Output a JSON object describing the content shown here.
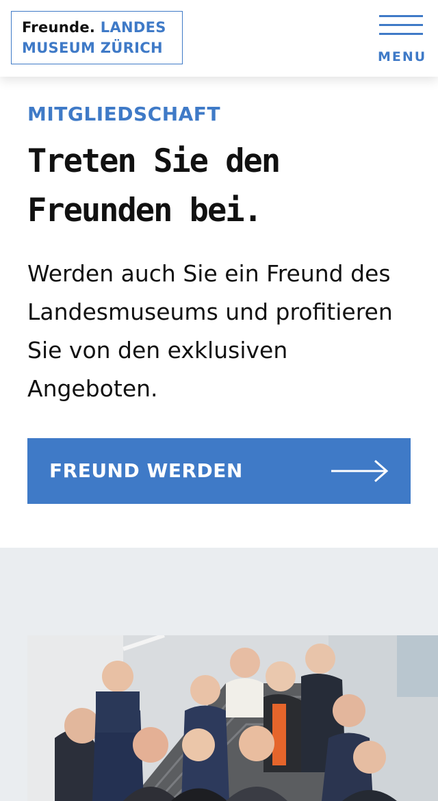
{
  "header": {
    "logo": {
      "part_dark": "Freunde.",
      "part_blue": "LANDES",
      "line2": "MUSEUM ZÜRICH"
    },
    "menu_label": "MENU"
  },
  "main": {
    "eyebrow": "MITGLIEDSCHAFT",
    "headline_line1": "Treten Sie den",
    "headline_line2": "Freunden bei.",
    "intro": "Werden auch Sie ein Freund des Landesmuseums und profitieren Sie von den exklusiven Angeboten.",
    "cta_label": "FREUND WERDEN",
    "cta_icon": "arrow-right-icon"
  },
  "colors": {
    "accent": "#3f7ac7",
    "section_bg": "#eaedf0",
    "text": "#111111"
  }
}
